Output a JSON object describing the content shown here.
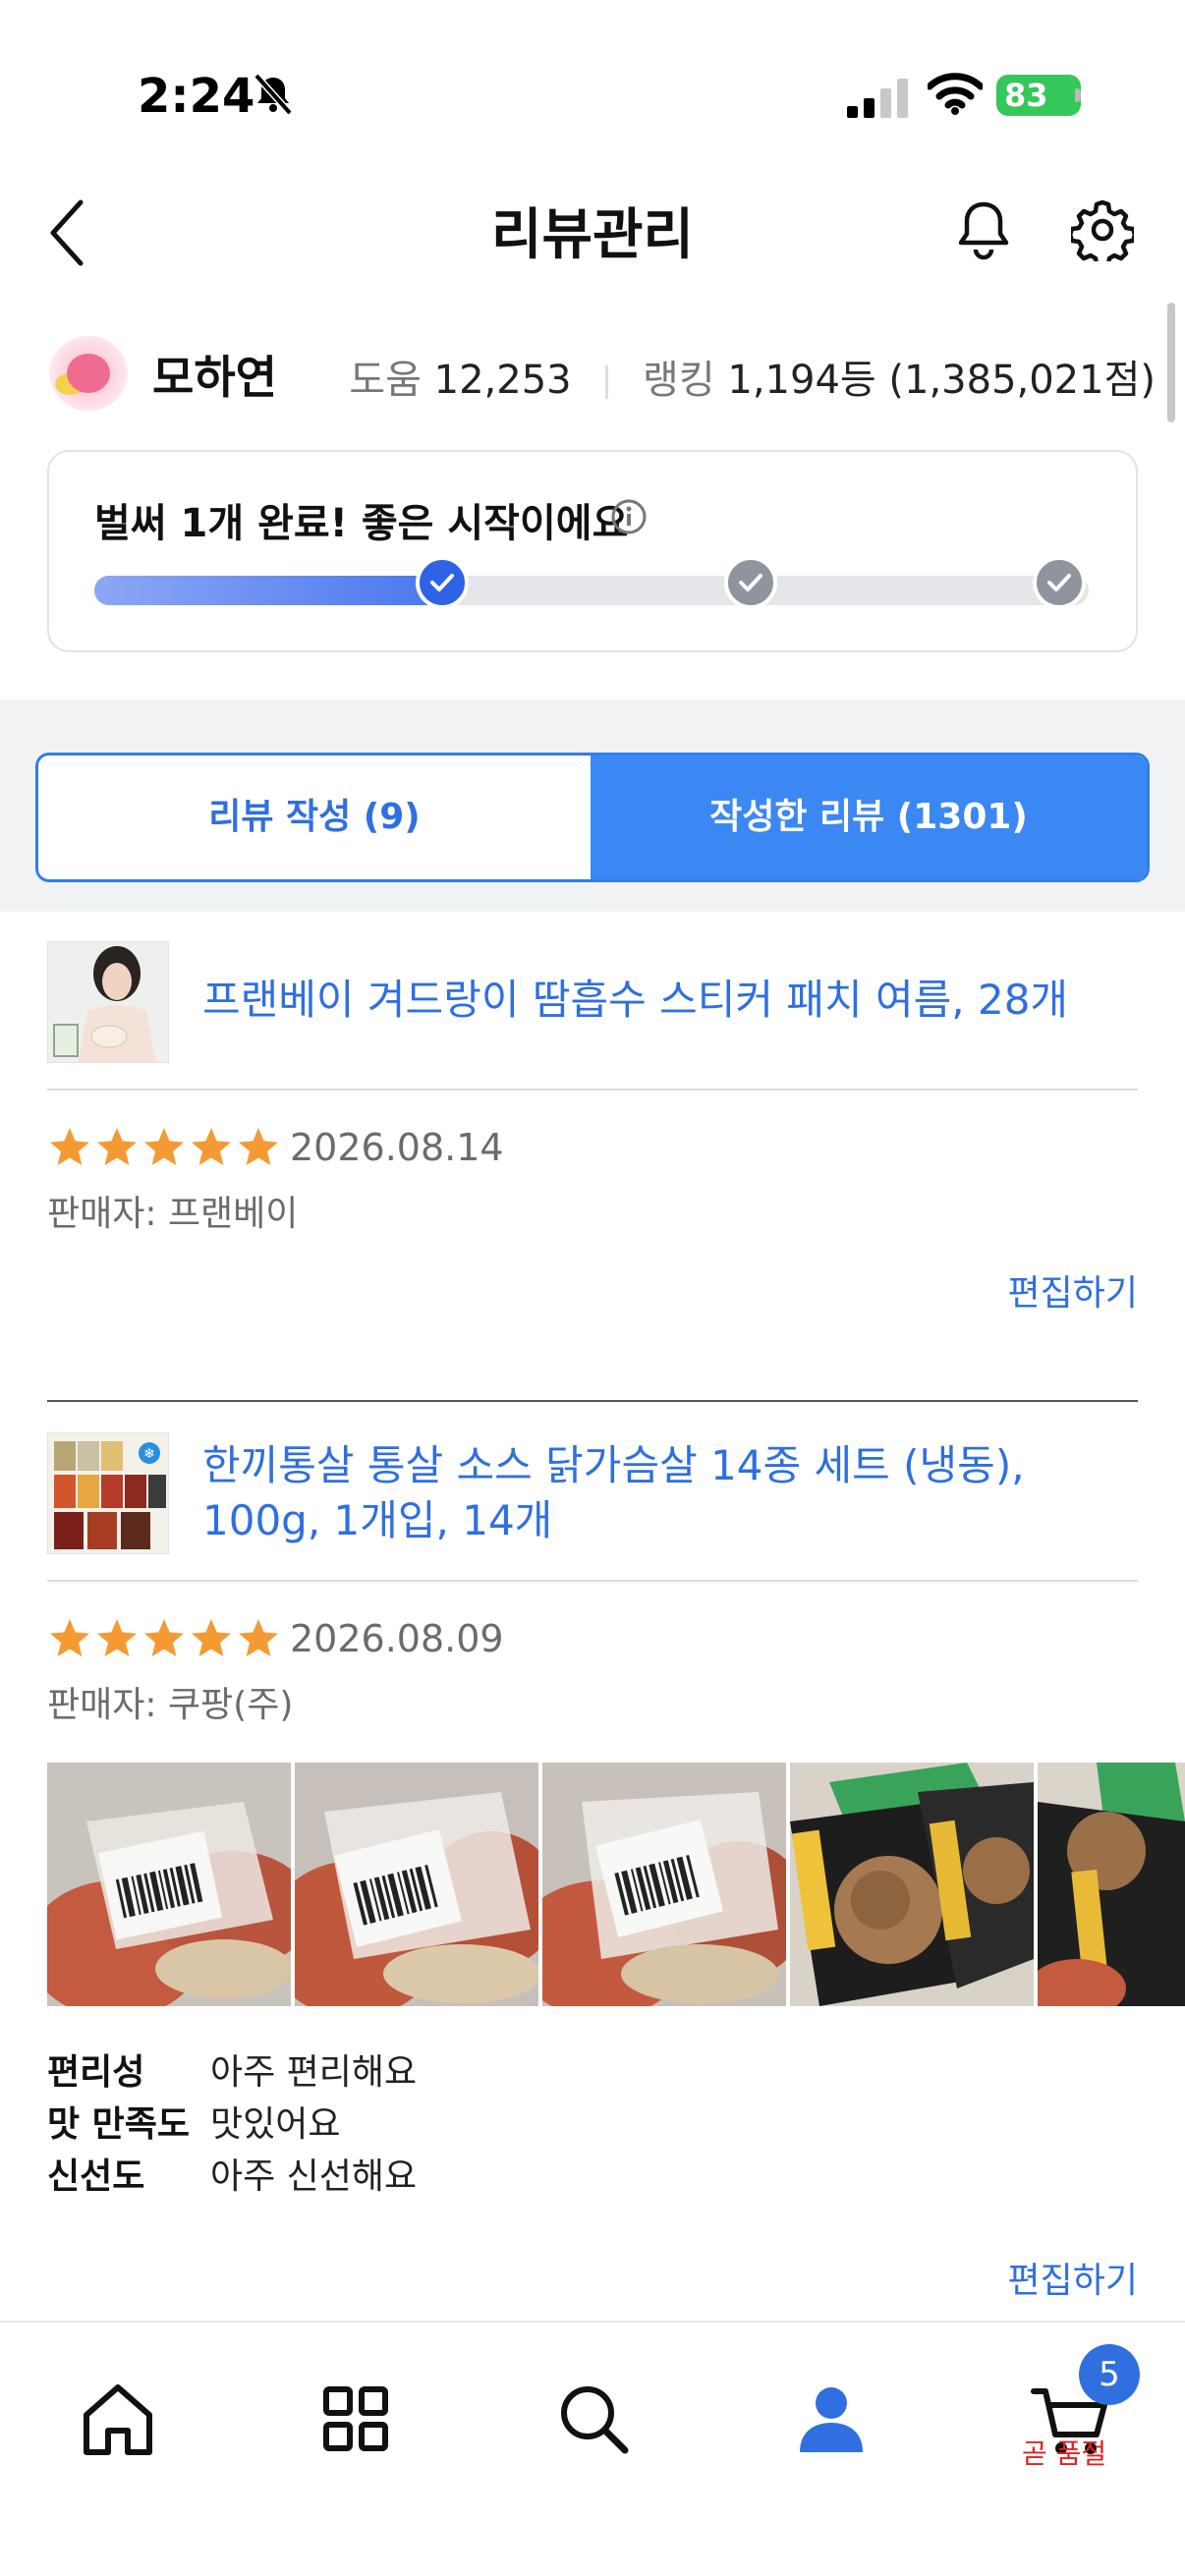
{
  "status_bar": {
    "time": "2:24",
    "battery": "83"
  },
  "header": {
    "title": "리뷰관리"
  },
  "profile": {
    "name": "모하연",
    "help_label": "도움",
    "help_count": "12,253",
    "rank_label": "랭킹",
    "rank_value": "1,194등 (1,385,021점)"
  },
  "progress": {
    "message": "벌써 1개 완료! 좋은 시작이에요",
    "completed_steps": 1,
    "total_steps": 3
  },
  "tabs": {
    "write": "리뷰 작성 (9)",
    "written": "작성한 리뷰 (1301)",
    "active": "written"
  },
  "reviews": [
    {
      "product": "프랜베이 겨드랑이 땀흡수 스티커 패치 여름, 28개",
      "rating": 5,
      "date": "2026.08.14",
      "seller": "판매자: 프랜베이",
      "edit_label": "편집하기"
    },
    {
      "product_line1": "한끼통살 통살 소스 닭가슴살 14종 세트 (냉동),",
      "product_line2": "100g, 1개입, 14개",
      "rating": 5,
      "date": "2026.08.09",
      "seller": "판매자: 쿠팡(주)",
      "photo_count_visible": 5,
      "attributes": [
        {
          "key": "편리성",
          "value": "아주 편리해요"
        },
        {
          "key": "맛 만족도",
          "value": "맛있어요"
        },
        {
          "key": "신선도",
          "value": "아주 신선해요"
        }
      ],
      "edit_label": "편집하기"
    }
  ],
  "bottom_nav": {
    "items": [
      "home-icon",
      "category-grid-icon",
      "search-icon",
      "my-page-icon",
      "cart-icon"
    ],
    "active": "my-page-icon",
    "cart_badge": "5",
    "cart_note": "곧 품절"
  },
  "colors": {
    "accent": "#3b87f4",
    "link": "#2f6fe0",
    "star": "#f59a33",
    "soldout": "#e0221e"
  }
}
